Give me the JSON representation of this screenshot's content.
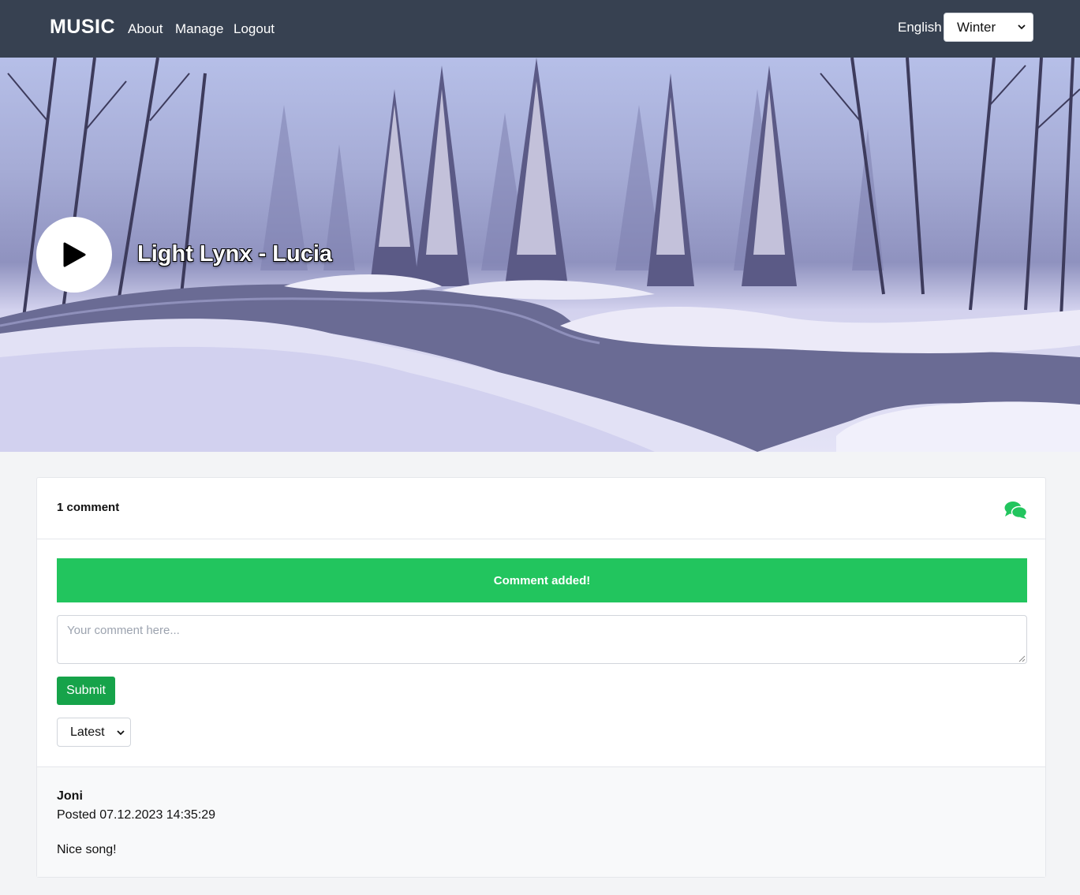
{
  "header": {
    "brand": "MUSIC",
    "nav": {
      "about": "About",
      "manage": "Manage",
      "logout": "Logout"
    },
    "language": "English",
    "season_selected": "Winter"
  },
  "hero": {
    "title": "Light Lynx - Lucia",
    "play_icon": "play-icon"
  },
  "comments": {
    "count_label": "1 comment",
    "icon": "comments-icon",
    "alert": "Comment added!",
    "placeholder": "Your comment here...",
    "submit_label": "Submit",
    "sort_selected": "Latest",
    "items": [
      {
        "author": "Joni",
        "posted": "Posted 07.12.2023 14:35:29",
        "body": "Nice song!"
      }
    ]
  },
  "colors": {
    "header_bg": "#374151",
    "accent_green": "#22c55e",
    "button_green": "#16a34a",
    "page_bg": "#f3f4f6"
  }
}
